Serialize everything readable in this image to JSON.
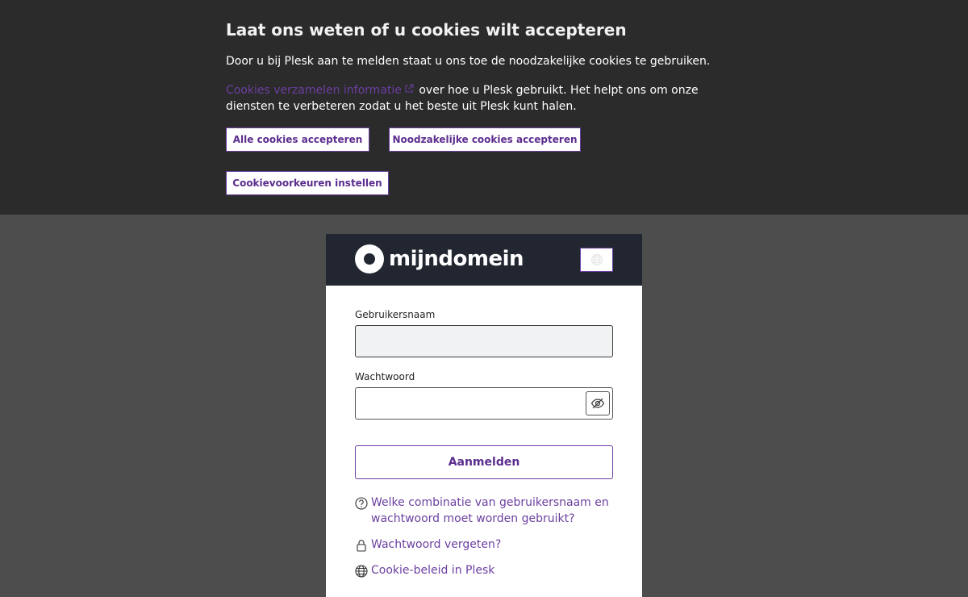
{
  "cookie_banner": {
    "title": "Laat ons weten of u cookies wilt accepteren",
    "text1": "Door u bij Plesk aan te melden staat u ons toe de noodzakelijke cookies te gebruiken.",
    "link": "Cookies verzamelen informatie",
    "text2": "over hoe u Plesk gebruikt. Het helpt ons om onze diensten te verbeteren zodat u het beste uit Plesk kunt halen.",
    "accept_all": "Alle cookies accepteren",
    "accept_necessary": "Noodzakelijke cookies accepteren",
    "preferences": "Cookievoorkeuren instellen"
  },
  "header": {
    "logo_text": "mijndomein",
    "lang_icon": "globe-icon"
  },
  "login": {
    "username_label": "Gebruikersnaam",
    "username_value": "",
    "password_label": "Wachtwoord",
    "password_value": "",
    "toggle_icon": "eye-slash-icon",
    "submit": "Aanmelden"
  },
  "links": {
    "help": "Welke combinatie van gebruikersnaam en wachtwoord moet worden gebruikt?",
    "help_icon": "question-circle-icon",
    "forgot": "Wachtwoord vergeten?",
    "forgot_icon": "lock-icon",
    "cookie_policy": "Cookie-beleid in Plesk",
    "cookie_policy_icon": "globe-icon"
  },
  "colors": {
    "banner_bg": "#2b2b2b",
    "page_bg": "#4d4d4d",
    "header_bg": "#212630",
    "accent": "#6b3fa0"
  }
}
